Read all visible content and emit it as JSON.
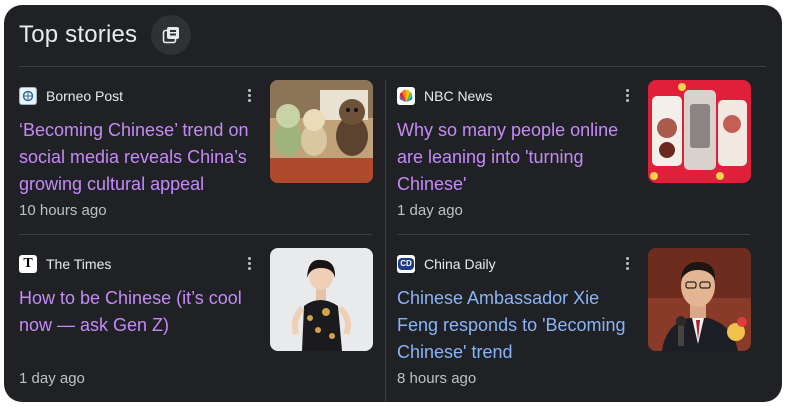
{
  "header": {
    "title": "Top stories"
  },
  "stories": [
    {
      "source": "Borneo Post",
      "headline": "‘Becoming Chinese’ trend on social media reveals China’s growing cultural appeal",
      "time": "10 hours ago"
    },
    {
      "source": "NBC News",
      "headline": "Why so many people online are leaning into 'turning Chinese'",
      "time": "1 day ago"
    },
    {
      "source": "The Times",
      "source_icon_letter": "T",
      "headline": "How to be Chinese (it’s cool now — ask Gen Z)",
      "time": "1 day ago"
    },
    {
      "source": "China Daily",
      "source_icon_letter": "CD",
      "headline": "Chinese Ambassador Xie Feng responds to 'Becoming Chinese' trend",
      "time": "8 hours ago"
    }
  ],
  "colors": {
    "background": "#202124",
    "headline_visited": "#c58af9",
    "headline_link": "#8ab4f8",
    "text_secondary": "#bdc1c6",
    "divider": "#3c4043"
  },
  "icons": {
    "header_button": "stack-icon",
    "story_menu": "more-vert-icon"
  }
}
